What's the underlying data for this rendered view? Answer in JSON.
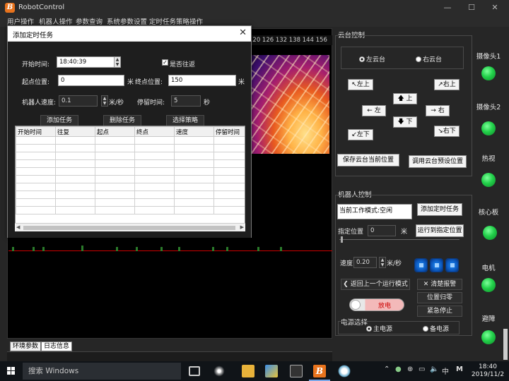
{
  "window": {
    "title": "RobotControl",
    "app_icon_letter": "B"
  },
  "menu": [
    "用户操作",
    "机器人操作",
    "参数查询",
    "系统参数设置",
    "定时任务策略操作"
  ],
  "ruler": {
    "ticks": "120 126 132 138 144 156"
  },
  "dialog": {
    "title": "添加定时任务",
    "start_time_label": "开始时间:",
    "start_time_value": "18:40:39",
    "round_trip_label": "是否往返",
    "round_trip_checked": true,
    "start_pos_label": "起点位置:",
    "start_pos_value": "0",
    "start_pos_unit": "米",
    "end_pos_label": "终点位置:",
    "end_pos_value": "150",
    "end_pos_unit": "米",
    "speed_label": "机器人速度:",
    "speed_value": "0.1",
    "speed_unit": "米/秒",
    "dwell_label": "停留时间:",
    "dwell_value": "5",
    "dwell_unit": "秒",
    "add_task": "添加任务",
    "delete_task": "删除任务",
    "select_strategy": "选择策略",
    "columns": [
      "开始时间",
      "往复",
      "起点",
      "终点",
      "速度",
      "停留时间"
    ]
  },
  "ptz": {
    "group_title": "云台控制",
    "left_ptz": "左云台",
    "right_ptz": "右云台",
    "selected": "left",
    "up_left": "↖左上",
    "up": "🡅 上",
    "up_right": "↗右上",
    "left": "← 左",
    "right": "→ 右",
    "down_left": "↙左下",
    "down": "🡇 下",
    "down_right": "↘右下",
    "save_preset": "保存云台当前位置",
    "call_preset": "调用云台预设位置"
  },
  "robot": {
    "group_title": "机器人控制",
    "mode_text": "当前工作模式:空闲",
    "add_timed_task": "添加定时任务",
    "target_label": "指定位置",
    "target_value": "0",
    "target_unit": "米",
    "go_to_target": "运行到指定位置",
    "speed_label": "速度",
    "speed_value": "0.20",
    "speed_unit": "米/秒",
    "back_prev_mode": "返回上一个运行模式",
    "clear_alarm": "清楚报警",
    "reset_pos": "位置归零",
    "emergency_stop": "紧急停止",
    "discharge": "放电",
    "power_group_title": "电源选择",
    "main_power": "主电源",
    "backup_power": "备电源",
    "power_selected": "main"
  },
  "status": {
    "items": [
      "摄像头1",
      "摄像头2",
      "热视",
      "核心板",
      "电机",
      "避障"
    ],
    "led_color": "#22d04a"
  },
  "bottom_tabs": [
    "环境参数",
    "日志信息"
  ],
  "taskbar": {
    "search_placeholder": "搜索 Windows",
    "time": "18:40",
    "date": "2019/11/2",
    "ime": "中",
    "ime_mode": "M"
  }
}
